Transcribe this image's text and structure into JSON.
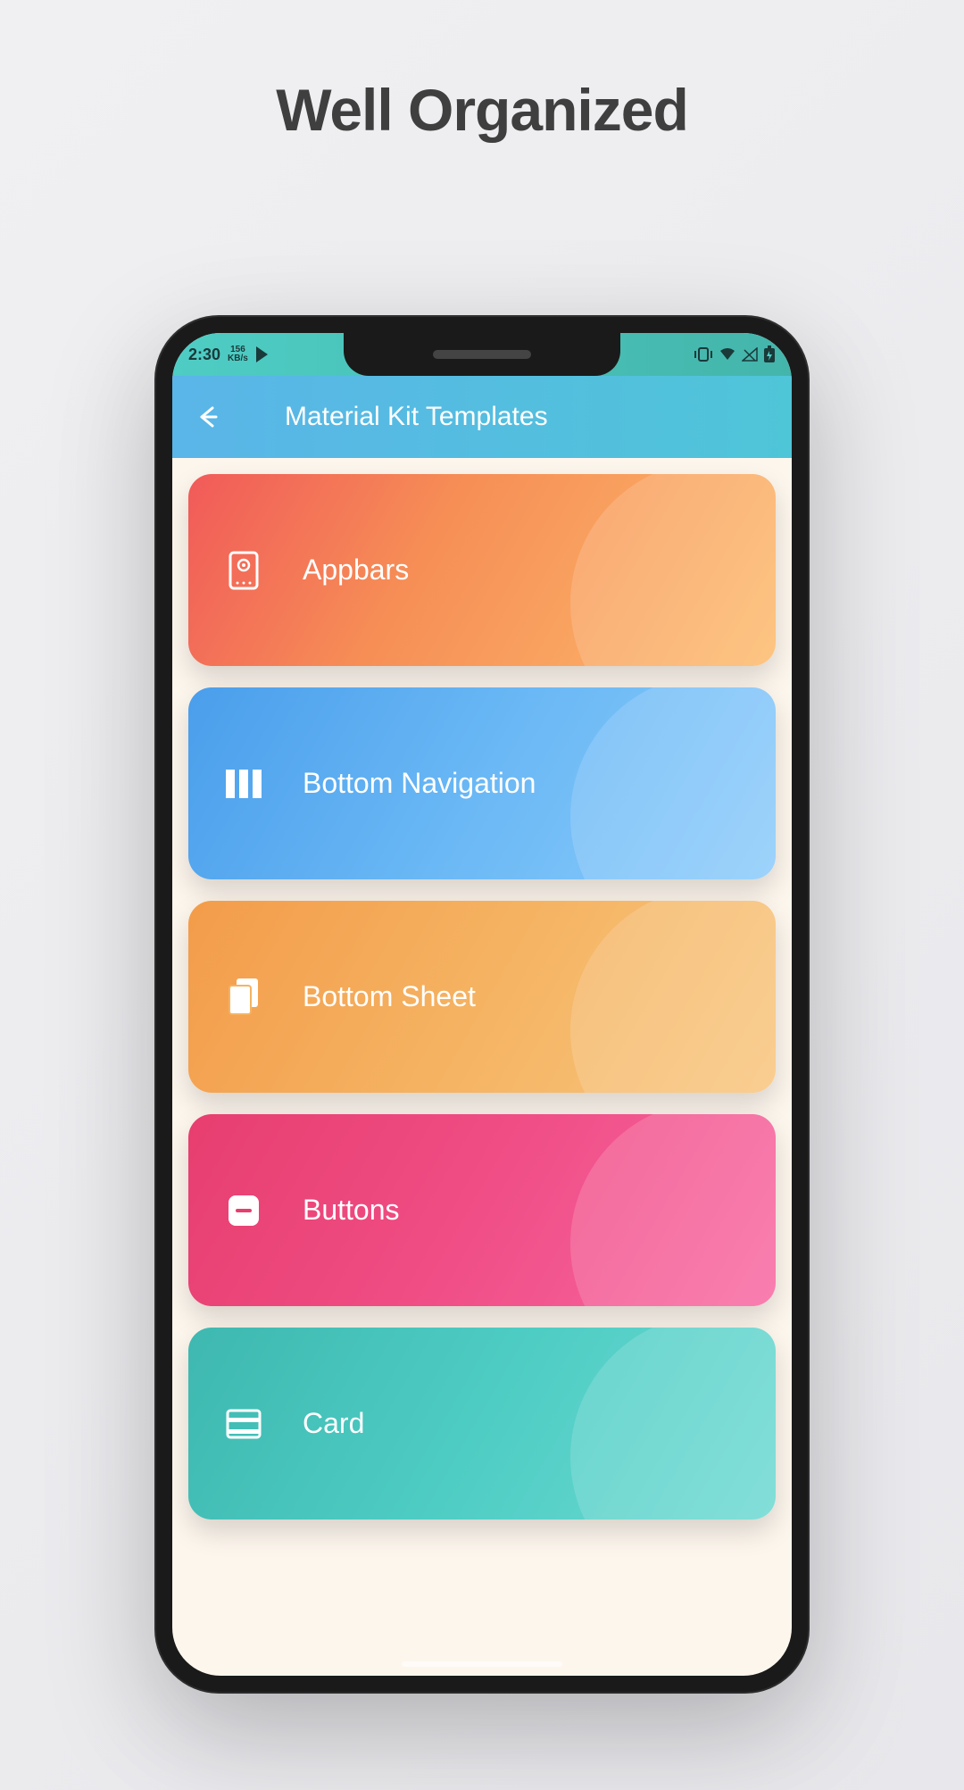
{
  "page": {
    "heading": "Well Organized"
  },
  "statusbar": {
    "time": "2:30",
    "speed_value": "156",
    "speed_unit": "KB/s"
  },
  "appbar": {
    "title": "Material Kit Templates"
  },
  "cards": [
    {
      "label": "Appbars",
      "icon": "device-frame-icon"
    },
    {
      "label": "Bottom Navigation",
      "icon": "columns-icon"
    },
    {
      "label": "Bottom Sheet",
      "icon": "sheets-icon"
    },
    {
      "label": "Buttons",
      "icon": "button-icon"
    },
    {
      "label": "Card",
      "icon": "card-icon"
    }
  ]
}
